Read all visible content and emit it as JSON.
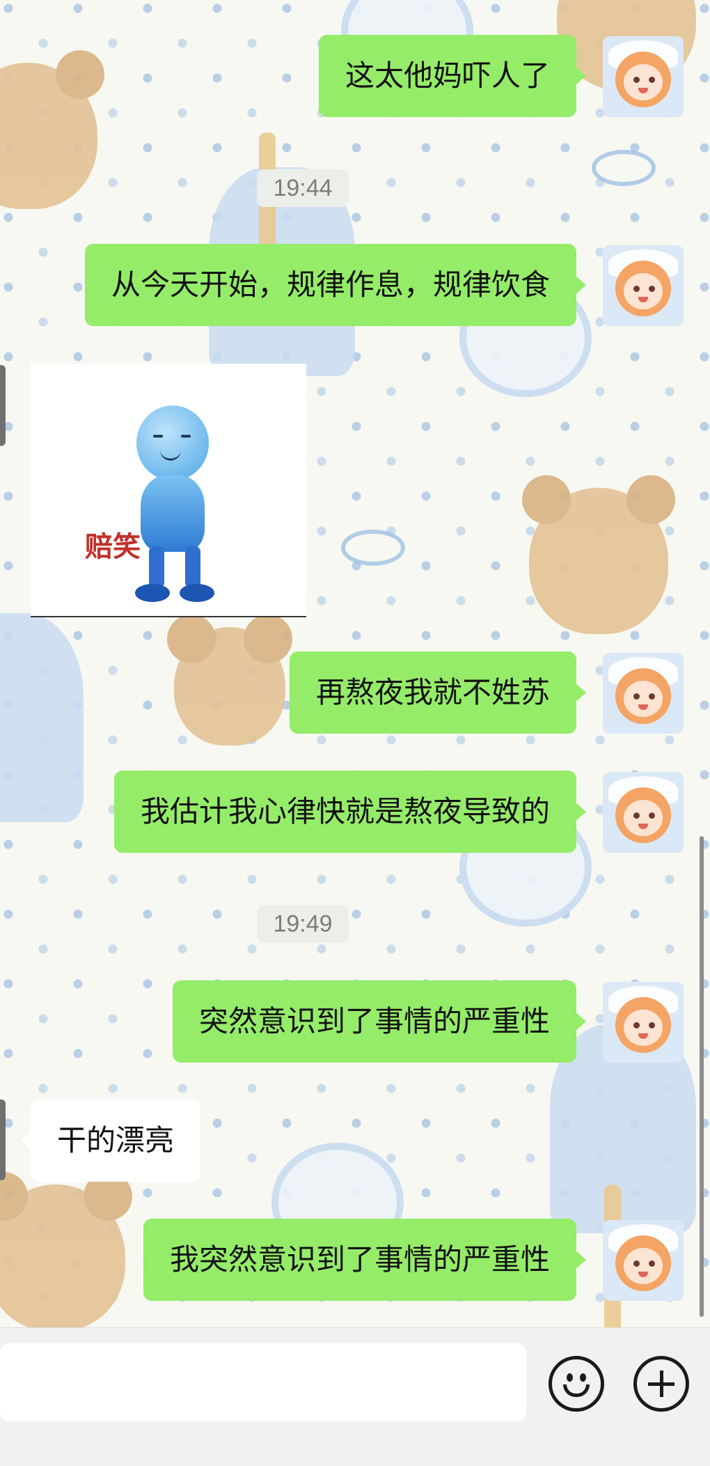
{
  "chat": {
    "messages": [
      {
        "id": "m1",
        "side": "right",
        "text": "这太他妈吓人了"
      },
      {
        "id": "t1",
        "type": "timestamp",
        "text": "19:44"
      },
      {
        "id": "m2",
        "side": "right",
        "text": "从今天开始，规律作息，规律饮食"
      },
      {
        "id": "m3",
        "side": "left",
        "type": "sticker",
        "caption": "赔笑"
      },
      {
        "id": "m4",
        "side": "right",
        "text": "再熬夜我就不姓苏"
      },
      {
        "id": "m5",
        "side": "right",
        "text": "我估计我心律快就是熬夜导致的"
      },
      {
        "id": "t2",
        "type": "timestamp",
        "text": "19:49"
      },
      {
        "id": "m6",
        "side": "right",
        "text": "突然意识到了事情的严重性"
      },
      {
        "id": "m7",
        "side": "left",
        "text": "干的漂亮"
      },
      {
        "id": "m8",
        "side": "right",
        "text": "我突然意识到了事情的严重性"
      }
    ]
  },
  "input_bar": {
    "placeholder": "",
    "emoji_icon": "emoji-smile-icon",
    "plus_icon": "plus-circle-icon"
  },
  "colors": {
    "sent_bubble": "#95ec69",
    "received_bubble": "#ffffff",
    "timestamp_bg": "#eceeea",
    "wallpaper": "#f7f8f2"
  }
}
